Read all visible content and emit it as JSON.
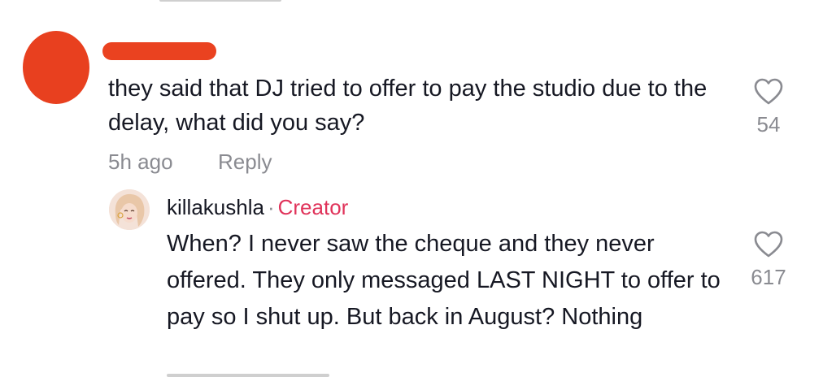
{
  "comment": {
    "text": "they said that DJ tried to offer to pay the studio due to the delay, what did you say?",
    "timestamp": "5h ago",
    "reply_label": "Reply",
    "likes": "54"
  },
  "reply": {
    "username": "killakushla",
    "separator": "·",
    "badge": "Creator",
    "text": "When? I never saw the cheque and they never offered. They only messaged LAST NIGHT to offer to pay so I shut up. But back in August? Nothing",
    "likes": "617"
  },
  "colors": {
    "redaction": "#ea4220",
    "creator_badge": "#e0335a",
    "meta_gray": "#8a8b91",
    "text": "#161823"
  },
  "icons": {
    "like": "heart-outline-icon"
  }
}
